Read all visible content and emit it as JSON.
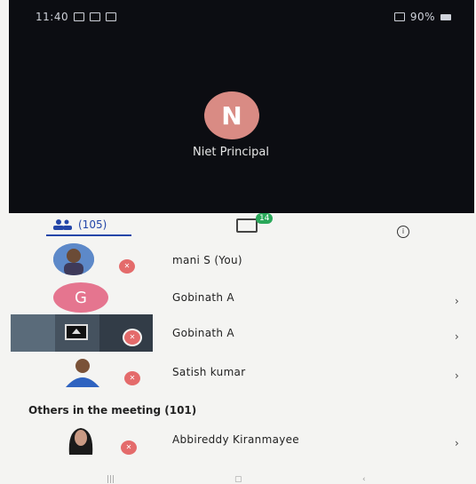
{
  "status_bar": {
    "time": "11:40",
    "right_text": "90%"
  },
  "host": {
    "initial": "N",
    "name": "Niet Principal"
  },
  "tabs": {
    "participants_label": "(105)",
    "chat_badge": "14"
  },
  "participants": [
    {
      "name": "mani S (You)",
      "avatar": "photo"
    },
    {
      "name": "Gobinath A",
      "initial": "G",
      "avatar_color": "#e5758f",
      "chevron": "›"
    },
    {
      "name": "Gobinath A",
      "avatar": "screen-share",
      "chevron": "›"
    },
    {
      "name": "Satish kumar",
      "avatar": "photo",
      "chevron": "›"
    }
  ],
  "others_section": {
    "title": "Others in the meeting (101)",
    "items": [
      {
        "name": "Abbireddy Kiranmayee",
        "chevron": "›"
      }
    ]
  },
  "colors": {
    "accent": "#2346a8",
    "muted_mic": "#e46b6b",
    "chat_badge": "#2aa85a",
    "host_avatar": "#d98b84"
  },
  "icons": [
    "participants-icon",
    "chat-icon",
    "info-icon",
    "mic-off-icon",
    "chevron-right-icon"
  ]
}
